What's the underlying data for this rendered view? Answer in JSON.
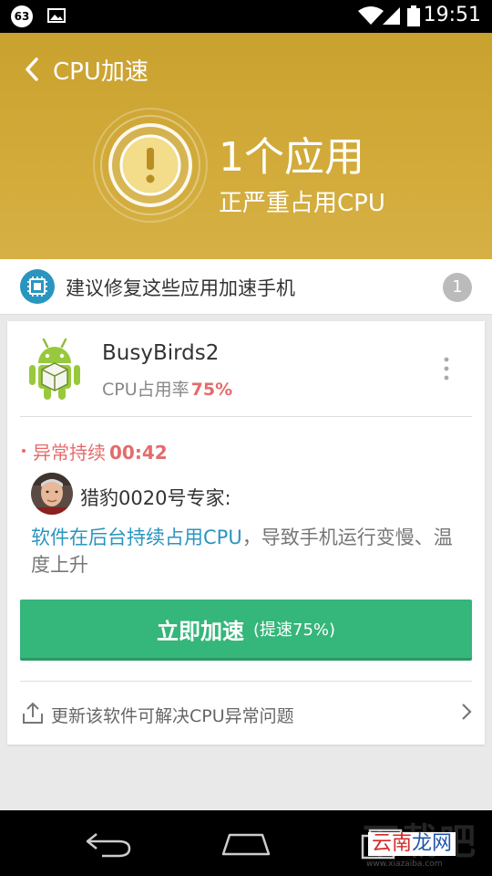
{
  "status_bar": {
    "notification_count": "63",
    "time": "19:51",
    "icons": [
      "gallery-icon",
      "wifi-icon",
      "signal-icon",
      "battery-icon"
    ]
  },
  "header": {
    "title": "CPU加速",
    "count_title": "1个应用",
    "count_subtitle": "正严重占用CPU",
    "background_color": "#c9a12f"
  },
  "suggestion": {
    "text": "建议修复这些应用加速手机",
    "count": "1",
    "icon": "chip-icon"
  },
  "app": {
    "name": "BusyBirds2",
    "cpu_label": "CPU占用率",
    "cpu_value": "75%",
    "icon": "android-icon",
    "anomaly_label": "异常持续",
    "anomaly_duration": "00:42",
    "expert_name": "猎豹0020号专家:",
    "description_highlight": "软件在后台持续占用CPU",
    "description_rest": "，导致手机运行变慢、温度上升",
    "accelerate_label": "立即加速",
    "accelerate_sub": "(提速75%)",
    "update_text": "更新该软件可解决CPU异常问题",
    "accent_red": "#e56b6b",
    "accent_blue": "#2a95bf",
    "button_color": "#35b67a"
  },
  "watermark": {
    "big": "下载吧",
    "yun": "云",
    "nan": "南",
    "long": "龙",
    "wang": "网",
    "url": "www.xiazaiba.com"
  }
}
